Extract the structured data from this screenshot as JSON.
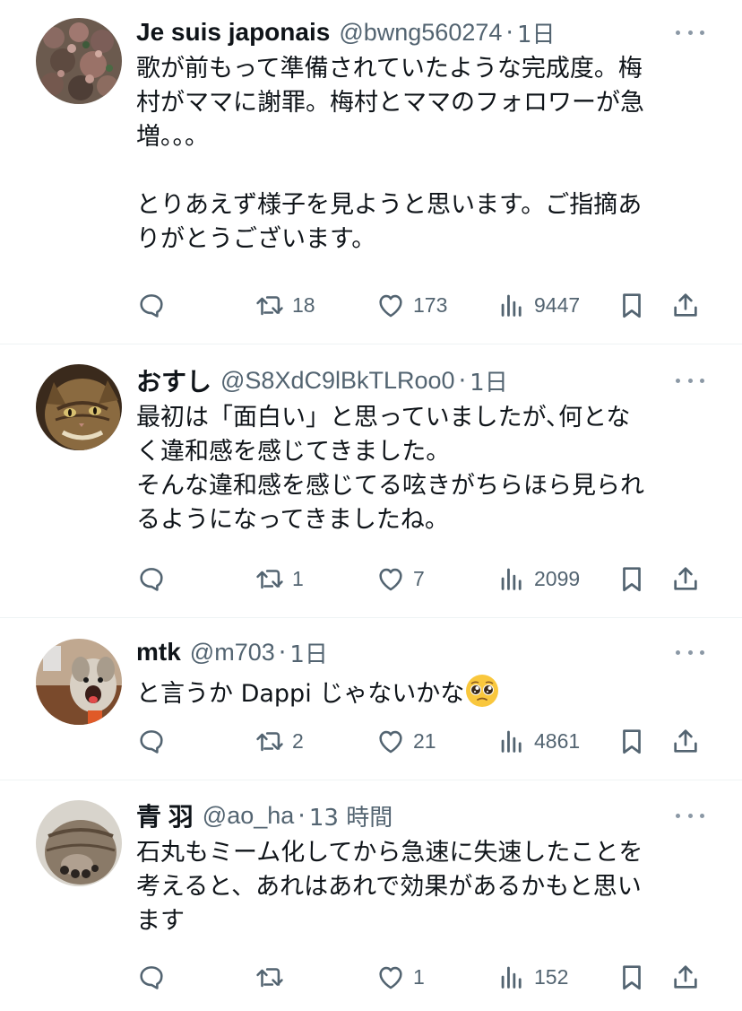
{
  "colors": {
    "text": "#0f1419",
    "secondary": "#536471",
    "divider": "#eff3f4",
    "icon": "#536471"
  },
  "tweets": [
    {
      "display_name": "Je suis japonais",
      "handle": "@bwng560274",
      "separator": "·",
      "time": "1日",
      "avatar_icon": "flowers-avatar",
      "lines": [
        "歌が前もって準備されていたような完成度。梅",
        "村がママに謝罪。梅村とママのフォロワーが急",
        "増。。。",
        "",
        "とりあえず様子を見ようと思います。ご指摘あ",
        "りがとうございます。"
      ],
      "reply_count": "",
      "retweet_count": "18",
      "like_count": "173",
      "view_count": "9447"
    },
    {
      "display_name": "おすし",
      "handle": "@S8XdC9lBkTLRoo0",
      "separator": "·",
      "time": "1日",
      "avatar_icon": "cat-avatar",
      "lines": [
        "最初は「面白い」と思っていましたが､何とな",
        "く違和感を感じてきました。",
        "そんな違和感を感じてる呟きがちらほら見られ",
        "るようになってきましたね。"
      ],
      "reply_count": "",
      "retweet_count": "1",
      "like_count": "7",
      "view_count": "2099"
    },
    {
      "display_name": "mtk",
      "handle": "@m703",
      "separator": "·",
      "time": "1日",
      "avatar_icon": "dog-avatar",
      "lines": [
        "と言うか Dappi じゃないかな"
      ],
      "emoji": "pleading-face-emoji",
      "reply_count": "",
      "retweet_count": "2",
      "like_count": "21",
      "view_count": "4861"
    },
    {
      "display_name": "青 羽",
      "handle": "@ao_ha",
      "separator": "·",
      "time": "13 時間",
      "avatar_icon": "cat-paw-avatar",
      "lines": [
        "石丸もミーム化してから急速に失速したことを",
        "考えると、あれはあれで効果があるかもと思い",
        "ます"
      ],
      "reply_count": "",
      "retweet_count": "",
      "like_count": "1",
      "view_count": "152"
    }
  ]
}
